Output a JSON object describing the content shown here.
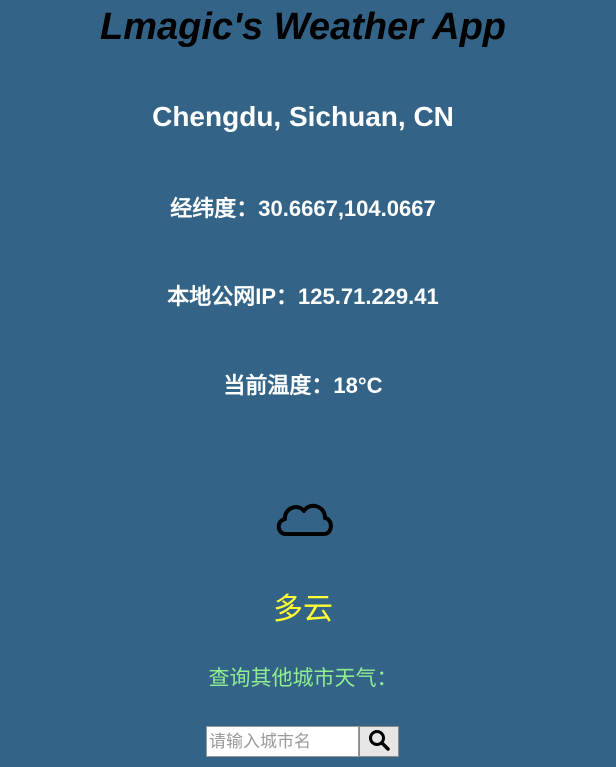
{
  "app": {
    "title": "Lmagic's Weather App"
  },
  "location": {
    "name": "Chengdu, Sichuan, CN"
  },
  "info": {
    "coordinates": "经纬度：30.6667,104.0667",
    "public_ip": "本地公网IP：125.71.229.41",
    "temperature": "当前温度：18°C"
  },
  "weather": {
    "icon": "cloud-icon",
    "condition": "多云"
  },
  "search": {
    "label": "查询其他城市天气：",
    "placeholder": "请输入城市名",
    "value": "",
    "button_icon": "search-icon"
  },
  "colors": {
    "background": "#336488",
    "title": "#000000",
    "info_text": "#ffffff",
    "condition": "#ffff33",
    "query_label": "#90ee90"
  }
}
